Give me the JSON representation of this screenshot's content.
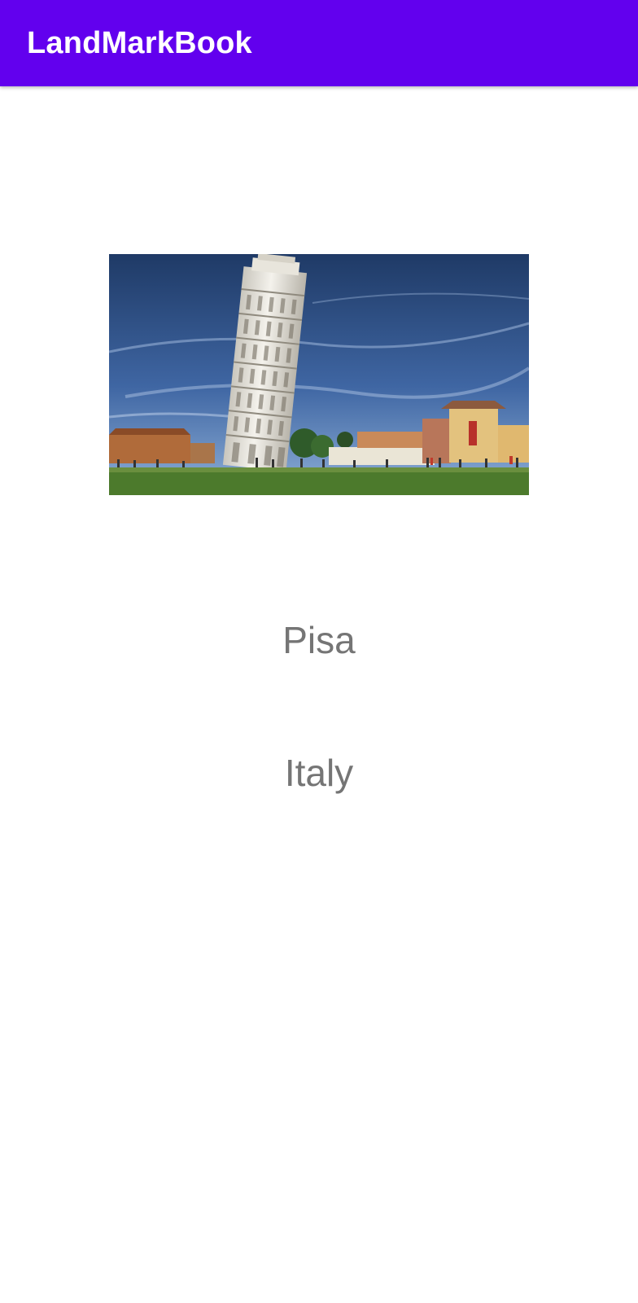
{
  "app_bar": {
    "title": "LandMarkBook",
    "background_color": "#6200ee",
    "title_color": "#ffffff"
  },
  "landmark": {
    "image_icon": "leaning-tower-photo",
    "name": "Pisa",
    "country": "Italy",
    "text_color": "#757575"
  }
}
